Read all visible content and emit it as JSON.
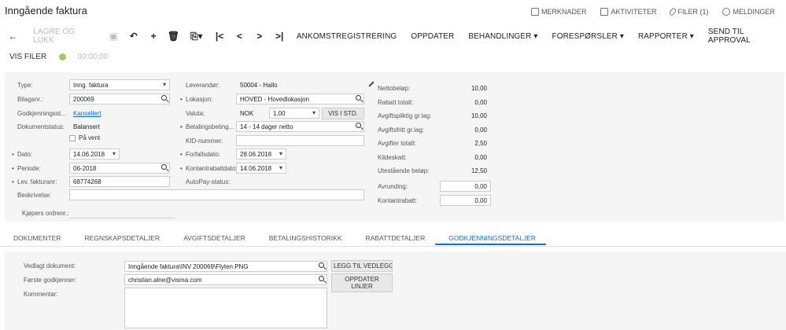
{
  "page": {
    "title": "Inngående faktura"
  },
  "top_actions": [
    {
      "label": "MERKNADER",
      "icon": "edit-note-icon"
    },
    {
      "label": "AKTIVITETER",
      "icon": "calendar-icon"
    },
    {
      "label": "FILER (1)",
      "icon": "paperclip-icon"
    },
    {
      "label": "MELDINGER",
      "icon": "alarm-clock-icon"
    }
  ],
  "toolbar": {
    "save_close": "LAGRE OG LUKK",
    "arrival": "ANKOMSTREGISTRERING",
    "update": "OPPDATER",
    "actions": "BEHANDLINGER",
    "inquiries": "FORESPØRSLER",
    "reports": "RAPPORTER",
    "send_approval": "SEND TIL APPROVAL"
  },
  "row2": {
    "show_files": "VIS FILER",
    "timer": "00:00:00"
  },
  "form": {
    "type_label": "Type:",
    "type_value": "Inng. faktura",
    "doc_label": "Bilagsnr.:",
    "doc_value": "200069",
    "approval_label": "Godkjenningsst...",
    "approval_value": "Kansellert",
    "docstatus_label": "Dokumentstatus:",
    "docstatus_value": "Balansert",
    "onhold_label": "På vent",
    "date_label": "Dato:",
    "date_value": "14.06.2018",
    "period_label": "Periode:",
    "period_value": "06-2018",
    "vendor_invoice_label": "Lev. fakturanr:",
    "vendor_invoice_value": "68774268",
    "description_label": "Beskrivelse:",
    "description_value": "",
    "buyer_order_label": "Kjøpers ordrenr.:",
    "buyer_order_value": "",
    "vendor_label": "Leverandør:",
    "vendor_value": "50004 - Hallo",
    "location_label": "Lokasjon:",
    "location_value": "HOVED - Hovedlokasjon",
    "currency_label": "Valuta:",
    "currency_value": "NOK",
    "rate_value": "1,00",
    "std_button": "VIS I STD.",
    "terms_label": "Betalingsbeting...",
    "terms_value": "14 - 14 dager netto",
    "kid_label": "KID-nummer:",
    "kid_value": "",
    "due_label": "Forfallsdato:",
    "due_value": "28.06.2018",
    "cashdisc_label": "Kontantrabattdato:",
    "cashdisc_value": "14.06.2018",
    "autopay_label": "AutoPay-status:",
    "autopay_value": ""
  },
  "totals": [
    {
      "label": "Nettobeløp:",
      "value": "10,00"
    },
    {
      "label": "Rabatt totalt:",
      "value": "0,00"
    },
    {
      "label": "Avgiftspliktig gr.lag:",
      "value": "10,00"
    },
    {
      "label": "Avgiftsfritt gr.lag:",
      "value": "0,00"
    },
    {
      "label": "Avgifter totalt:",
      "value": "2,50"
    },
    {
      "label": "Kildeskatt:",
      "value": "0,00"
    },
    {
      "label": "Utestående beløp:",
      "value": "12,50"
    },
    {
      "label": "Avrunding:",
      "value": "0,00"
    },
    {
      "label": "Kontantrabatt:",
      "value": "0,00"
    }
  ],
  "tabs": [
    "DOKUMENTER",
    "REGNSKAPSDETALJER",
    "AVGIFTSDETALJER",
    "BETALINGSHISTORIKK",
    "RABATTDETALJER",
    "GODKJENNINGSDETALJER"
  ],
  "details": {
    "attached_label": "Vedlagt dokument:",
    "attached_value": "Inngående faktura\\INV 200069\\Flyten.PNG",
    "attach_button": "LEGG TIL VEDLEGG",
    "first_approver_label": "Første godkjenner:",
    "first_approver_value": "christian.alne@visma.com",
    "update_lines_button": "OPPDATER LINJER",
    "comment_label": "Kommentar:",
    "comment_value": ""
  }
}
